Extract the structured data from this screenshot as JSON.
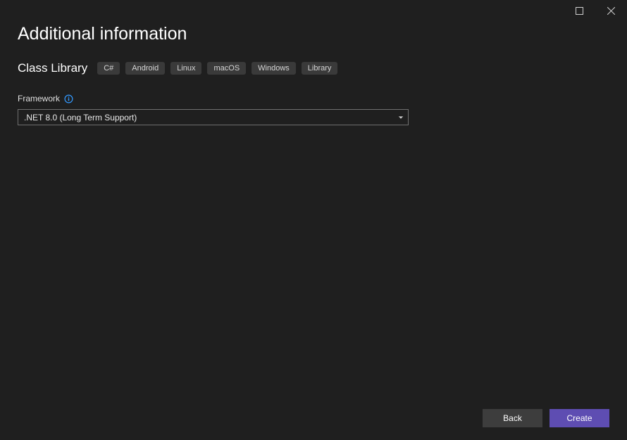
{
  "header": {
    "title": "Additional information"
  },
  "project": {
    "name": "Class Library",
    "tags": [
      "C#",
      "Android",
      "Linux",
      "macOS",
      "Windows",
      "Library"
    ]
  },
  "framework": {
    "label": "Framework",
    "selected": ".NET 8.0 (Long Term Support)"
  },
  "footer": {
    "back": "Back",
    "create": "Create"
  }
}
